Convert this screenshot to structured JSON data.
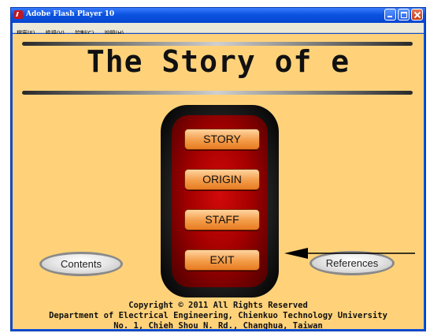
{
  "window": {
    "title": "Adobe Flash Player 10",
    "controls": {
      "minimize": "minimize",
      "maximize": "maximize",
      "close": "close"
    }
  },
  "menubar": {
    "items": [
      "檔案(F)",
      "檢視(V)",
      "控制(C)",
      "說明(H)"
    ]
  },
  "stage": {
    "title": "The Story of e",
    "menu": [
      "STORY",
      "ORIGIN",
      "STAFF",
      "EXIT"
    ],
    "contents_label": "Contents",
    "references_label": "References",
    "footer": [
      "Copyright © 2011 All Rights Reserved",
      "Department of Electrical Engineering, Chienkuo Technology University",
      "No. 1, Chieh Shou N. Rd., Changhua, Taiwan"
    ]
  },
  "colors": {
    "stage_background": "#ffd27a",
    "panel_red": "#c00000",
    "button_orange": "#f39c48"
  }
}
